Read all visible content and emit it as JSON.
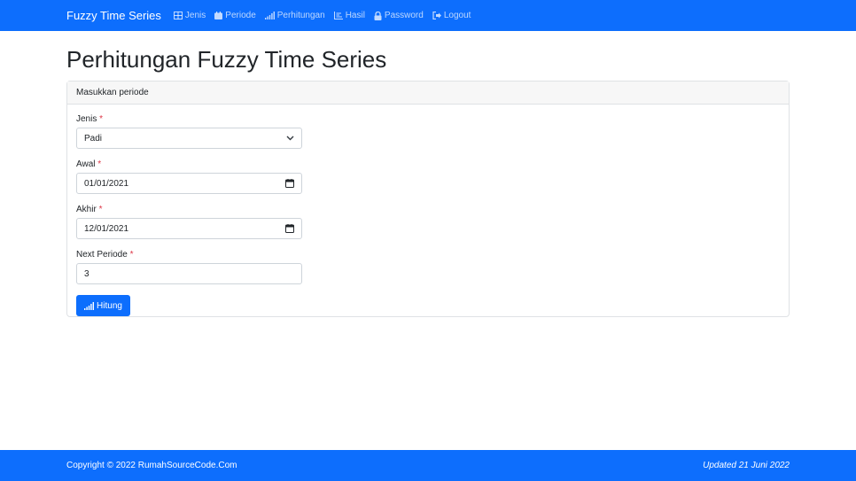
{
  "navbar": {
    "brand": "Fuzzy Time Series",
    "items": [
      {
        "label": "Jenis",
        "icon": "table-icon"
      },
      {
        "label": "Periode",
        "icon": "calendar-icon"
      },
      {
        "label": "Perhitungan",
        "icon": "bar-chart-icon"
      },
      {
        "label": "Hasil",
        "icon": "line-chart-icon"
      },
      {
        "label": "Password",
        "icon": "lock-icon"
      },
      {
        "label": "Logout",
        "icon": "logout-icon"
      }
    ]
  },
  "page": {
    "title": "Perhitungan Fuzzy Time Series"
  },
  "card": {
    "header": "Masukkan periode",
    "fields": {
      "jenis": {
        "label": "Jenis",
        "required": "*",
        "value": "Padi"
      },
      "awal": {
        "label": "Awal",
        "required": "*",
        "value": "01/01/2021"
      },
      "akhir": {
        "label": "Akhir",
        "required": "*",
        "value": "12/01/2021"
      },
      "next": {
        "label": "Next Periode",
        "required": "*",
        "value": "3"
      }
    },
    "submit_label": "Hitung"
  },
  "footer": {
    "copyright": "Copyright © 2022 RumahSourceCode.Com",
    "updated": "Updated 21 Juni 2022"
  },
  "colors": {
    "primary": "#0d6efd",
    "required": "#dc3545"
  }
}
